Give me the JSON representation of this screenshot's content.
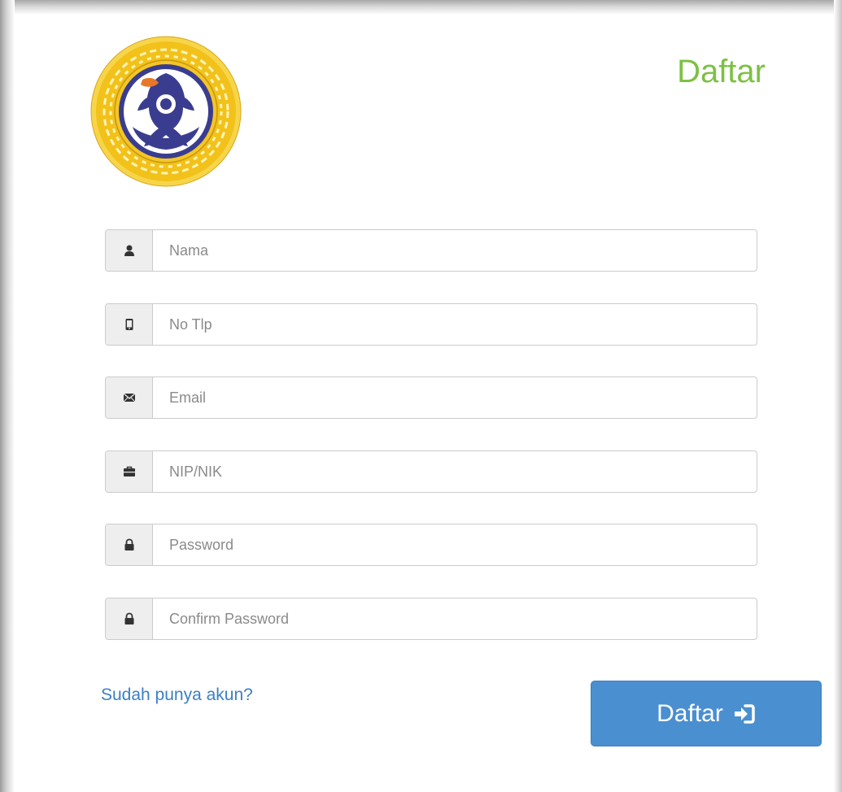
{
  "header": {
    "title": "Daftar"
  },
  "logo": {
    "name": "university-seal-logo",
    "colors": {
      "ring": "#f2c21b",
      "inner": "#3a3d8f",
      "accent": "#e8772a"
    }
  },
  "form": {
    "fields": [
      {
        "name": "nama-field",
        "icon": "user-icon",
        "placeholder": "Nama",
        "value": ""
      },
      {
        "name": "phone-field",
        "icon": "mobile-phone-icon",
        "placeholder": "No Tlp",
        "value": ""
      },
      {
        "name": "email-field",
        "icon": "envelope-icon",
        "placeholder": "Email",
        "value": ""
      },
      {
        "name": "nip-nik-field",
        "icon": "briefcase-icon",
        "placeholder": "NIP/NIK",
        "value": ""
      },
      {
        "name": "password-field",
        "icon": "lock-icon",
        "placeholder": "Password",
        "value": ""
      },
      {
        "name": "confirm-password-field",
        "icon": "lock-icon",
        "placeholder": "Confirm Password",
        "value": ""
      }
    ],
    "login_link": "Sudah punya akun?",
    "submit_label": "Daftar",
    "submit_icon": "log-in-icon"
  },
  "colors": {
    "title": "#7cc142",
    "link": "#3b7fc4",
    "button": "#4a8fd0"
  }
}
